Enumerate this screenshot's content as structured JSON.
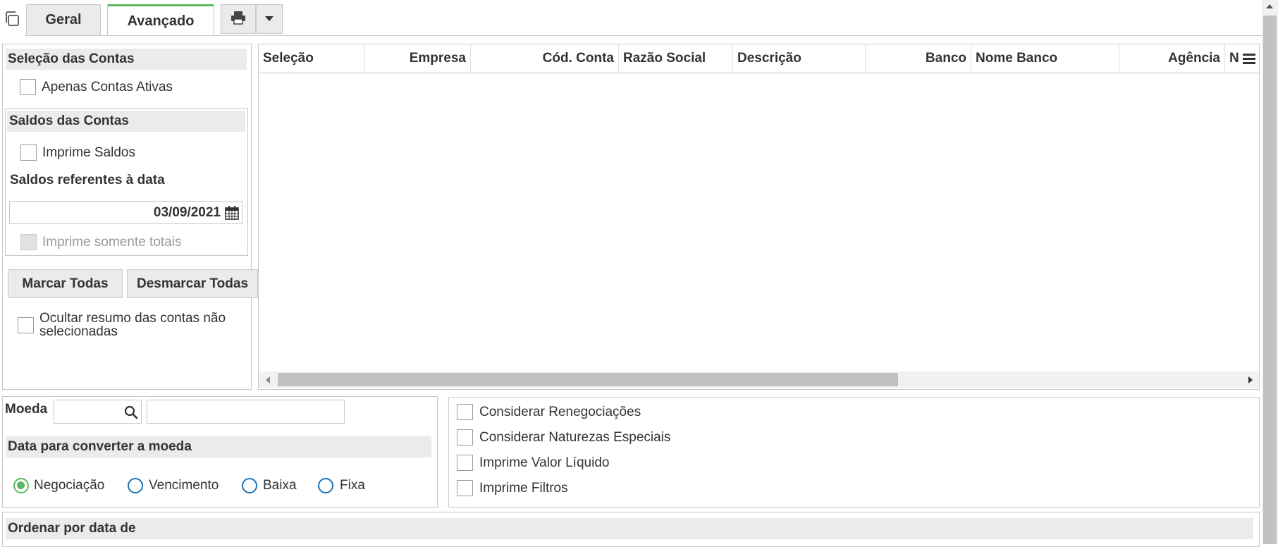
{
  "tabs": [
    {
      "label": "Geral"
    },
    {
      "label": "Avançado"
    }
  ],
  "icons": {
    "copy": "copy-icon",
    "print": "printer-icon",
    "dropdown": "caret-down-icon",
    "calendar": "calendar-icon",
    "search": "search-icon",
    "column_menu": "menu-icon"
  },
  "left_panel": {
    "selecao_title": "Seleção das Contas",
    "apenas_ativas": "Apenas Contas Ativas",
    "saldos_title": "Saldos das Contas",
    "imprime_saldos": "Imprime Saldos",
    "saldos_data_label": "Saldos referentes à data",
    "saldos_data_value": "03/09/2021",
    "imprime_totais": "Imprime somente totais",
    "marcar_todas": "Marcar Todas",
    "desmarcar_todas": "Desmarcar Todas",
    "ocultar_resumo": "Ocultar resumo das contas não selecionadas"
  },
  "grid": {
    "columns": [
      "Seleção",
      "Empresa",
      "Cód. Conta",
      "Razão Social",
      "Descrição",
      "Banco",
      "Nome Banco",
      "Agência",
      "N"
    ],
    "rows": []
  },
  "moeda": {
    "label": "Moeda",
    "code_value": "",
    "desc_value": "",
    "data_title": "Data para converter a moeda",
    "options": [
      "Negociação",
      "Vencimento",
      "Baixa",
      "Fixa"
    ],
    "selected": "Negociação"
  },
  "options": {
    "renegociacoes": "Considerar Renegociações",
    "naturezas": "Considerar Naturezas Especiais",
    "valor_liquido": "Imprime Valor Líquido",
    "filtros": "Imprime Filtros"
  },
  "ordenar": {
    "title": "Ordenar por data de"
  },
  "colors": {
    "accent_green": "#5cb85c",
    "radio_blue": "#1a73b5",
    "section_bg": "#ebebeb",
    "border": "#c8c8c8"
  }
}
